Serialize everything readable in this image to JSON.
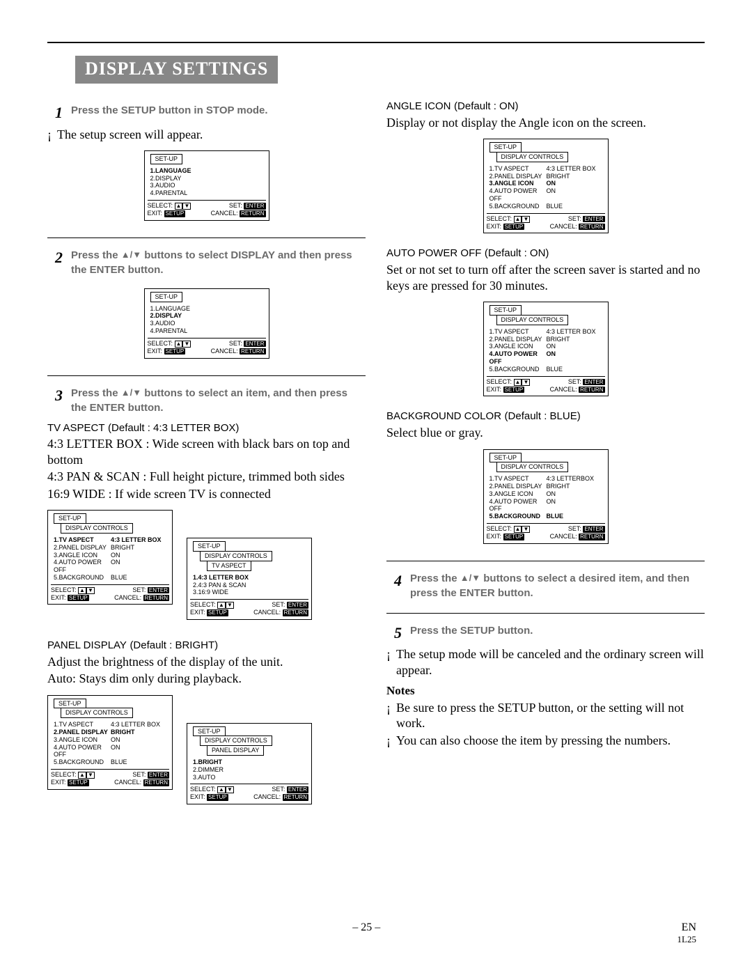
{
  "title": "DISPLAY SETTINGS",
  "steps": {
    "s1": "Press the SETUP button in STOP mode.",
    "s1_after": "The setup screen will appear.",
    "s2_a": "Press the ",
    "s2_b": " buttons to select DISPLAY and then press the ENTER button.",
    "s3_a": "Press the ",
    "s3_b": " buttons to select an item, and then press the ENTER button.",
    "s4_a": "Press the ",
    "s4_b": " buttons to select a desired item, and then press the ENTER button.",
    "s5": "Press the SETUP button.",
    "s5_after": "The setup mode will be canceled and the ordinary screen will appear."
  },
  "tv_aspect": {
    "label": "TV ASPECT",
    "default": "(Default : 4:3 LETTER BOX)",
    "l1": "4:3 LETTER BOX : Wide screen with black bars on top and bottom",
    "l2": "4:3 PAN & SCAN : Full height picture, trimmed both sides",
    "l3": "16:9 WIDE : If wide screen TV is connected"
  },
  "panel_display": {
    "label": "PANEL DISPLAY",
    "default": "(Default : BRIGHT)",
    "l1": "Adjust the brightness of the display of the unit.",
    "l2": "Auto: Stays dim only during playback."
  },
  "angle_icon": {
    "label": "ANGLE ICON",
    "default": "(Default : ON)",
    "l1": "Display or not display the Angle icon on the screen."
  },
  "auto_power_off": {
    "label": "AUTO POWER OFF",
    "default": "(Default : ON)",
    "l1": "Set or not set to turn off after the screen saver is started and no keys are pressed for 30 minutes."
  },
  "background": {
    "label": "BACKGROUND COLOR",
    "default": "(Default : BLUE)",
    "l1": "Select blue or gray."
  },
  "notes": {
    "hdr": "Notes",
    "n1": "Be sure to press the SETUP button, or the setting will not work.",
    "n2": "You can also choose the item by pressing the numbers."
  },
  "osd_labels": {
    "setup": "SET-UP",
    "display_controls": "DISPLAY CONTROLS",
    "tv_aspect": "TV ASPECT",
    "panel_display": "PANEL DISPLAY",
    "select": "SELECT:",
    "set": "SET:",
    "exit": "EXIT:",
    "cancel": "CANCEL:",
    "enter": "ENTER",
    "return": "RETURN",
    "setup_pill": "SETUP"
  },
  "osd_main": {
    "i1": "1.LANGUAGE",
    "i2": "2.DISPLAY",
    "i3": "3.AUDIO",
    "i4": "4.PARENTAL"
  },
  "osd_display": {
    "i1": "1.TV ASPECT",
    "v1": "4:3 LETTER BOX",
    "i2": "2.PANEL DISPLAY",
    "v2": "BRIGHT",
    "i3": "3.ANGLE ICON",
    "v3": "ON",
    "i4": "4.AUTO POWER OFF",
    "v4": "ON",
    "i5": "5.BACKGROUND",
    "v5": "BLUE"
  },
  "osd_tv_aspect_sub": {
    "i1": "1.4:3 LETTER BOX",
    "i2": "2.4:3 PAN & SCAN",
    "i3": "3.16:9 WIDE"
  },
  "osd_panel_sub": {
    "i1": "1.BRIGHT",
    "i2": "2.DIMMER",
    "i3": "3.AUTO"
  },
  "footer": {
    "page": "– 25 –",
    "lang": "EN",
    "code": "1L25"
  }
}
